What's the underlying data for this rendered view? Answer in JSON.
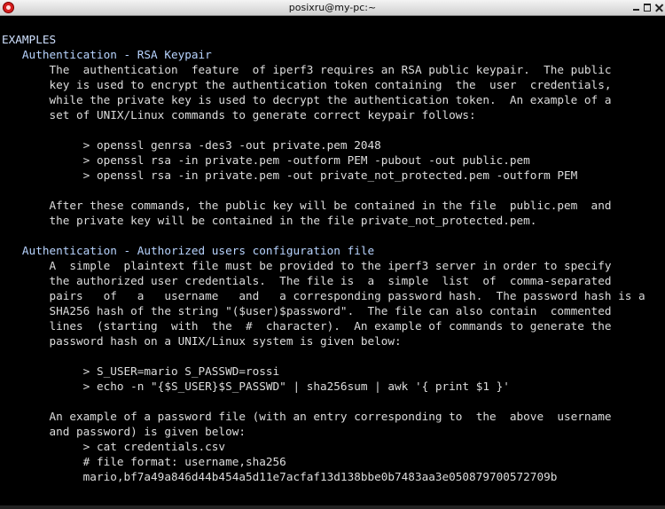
{
  "window": {
    "title": "posixru@my-pc:~",
    "icons": {
      "app": "app-icon",
      "minimize": "minimize-icon",
      "maximize": "maximize-icon",
      "close": "close-icon"
    }
  },
  "terminal": {
    "lines": [
      "EXAMPLES",
      "   Authentication - RSA Keypair",
      "       The  authentication  feature  of iperf3 requires an RSA public keypair.  The public",
      "       key is used to encrypt the authentication token containing  the  user  credentials,",
      "       while the private key is used to decrypt the authentication token.  An example of a",
      "       set of UNIX/Linux commands to generate correct keypair follows:",
      "",
      "            > openssl genrsa -des3 -out private.pem 2048",
      "            > openssl rsa -in private.pem -outform PEM -pubout -out public.pem",
      "            > openssl rsa -in private.pem -out private_not_protected.pem -outform PEM",
      "",
      "       After these commands, the public key will be contained in the file  public.pem  and",
      "       the private key will be contained in the file private_not_protected.pem.",
      "",
      "   Authentication - Authorized users configuration file",
      "       A  simple  plaintext file must be provided to the iperf3 server in order to specify",
      "       the authorized user credentials.  The file is  a  simple  list  of  comma-separated",
      "       pairs   of   a   username   and   a corresponding password hash.  The password hash is a",
      "       SHA256 hash of the string \"($user)$password\".  The file can also contain  commented",
      "       lines  (starting  with  the  #  character).  An example of commands to generate the",
      "       password hash on a UNIX/Linux system is given below:",
      "",
      "            > S_USER=mario S_PASSWD=rossi",
      "            > echo -n \"{$S_USER}$S_PASSWD\" | sha256sum | awk '{ print $1 }'",
      "",
      "       An example of a password file (with an entry corresponding to  the  above  username",
      "       and password) is given below:",
      "            > cat credentials.csv",
      "            # file format: username,sha256",
      "            mario,bf7a49a846d44b454a5d11e7acfaf13d138bbe0b7483aa3e050879700572709b",
      ""
    ]
  }
}
